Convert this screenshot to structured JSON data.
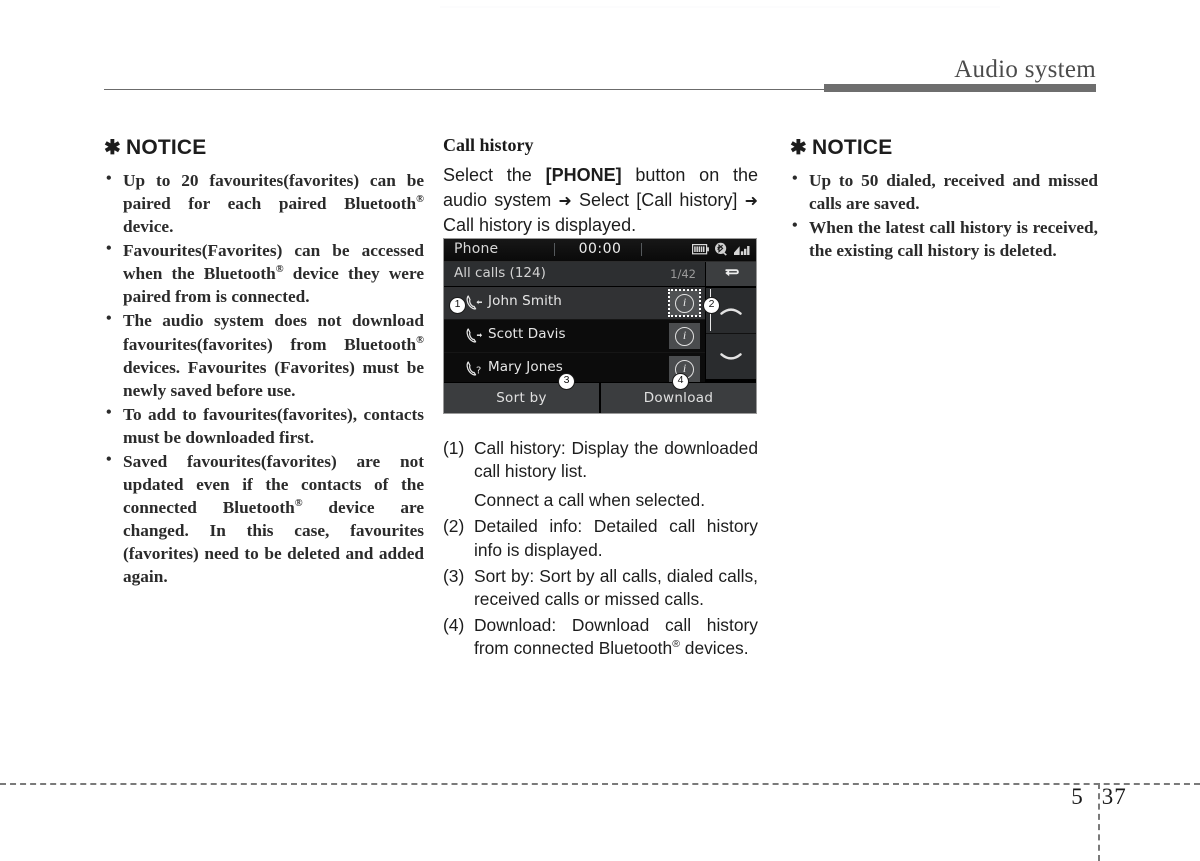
{
  "header": {
    "title": "Audio system"
  },
  "footer": {
    "chapter": "5",
    "page": "37"
  },
  "left_notice": {
    "star": "✱",
    "heading": "NOTICE",
    "items": [
      "Up to 20 favourites(favorites) can be paired for each paired Bluetooth® device.",
      "Favourites(Favorites) can be accessed when the Bluetooth® device they were paired from is connected.",
      "The audio system does not download favourites(favorites) from Bluetooth® devices. Favourites (Favorites) must be newly saved before use.",
      "To add to favourites(favorites), contacts must be downloaded first.",
      "Saved favourites(favorites) are not updated even if the contacts of the connected Bluetooth® device are changed. In this case, favourites (favorites) need to be deleted and added again."
    ]
  },
  "right_notice": {
    "star": "✱",
    "heading": "NOTICE",
    "items": [
      "Up to 50 dialed, received and missed calls are saved.",
      "When the latest call history is received, the existing call history is deleted."
    ]
  },
  "middle": {
    "section_title": "Call history",
    "description_part1": "Select the ",
    "description_phone_button": "[PHONE]",
    "description_part2": " button on the audio system ",
    "description_arrow1": "➜",
    "description_part3": " Select [Call history] ",
    "description_arrow2": "➜",
    "description_part4": " Call history is displayed.",
    "numbered_items": [
      {
        "marker": "(1)",
        "text": "Call history: Display the downloaded call history list.",
        "sub_line": "Connect a call when selected."
      },
      {
        "marker": "(2)",
        "text": "Detailed info: Detailed call history info is displayed.",
        "sub_line": ""
      },
      {
        "marker": "(3)",
        "text": "Sort by: Sort by all calls, dialed calls, received calls or missed calls.",
        "sub_line": ""
      },
      {
        "marker": "(4)",
        "text_before_reg": "Download: Download call history from connected Bluetooth",
        "reg": "®",
        "text_after_reg": " devices.",
        "sub_line": ""
      }
    ]
  },
  "device": {
    "title": "Phone",
    "clock": "00:00",
    "status_icons": [
      "battery-icon",
      "bluetooth-icon",
      "signal-icon"
    ],
    "subbar_label": "All calls (124)",
    "page_indicator": "1/42",
    "back_label": "back-arrow-icon",
    "scroll_up_label": "chevron-up-icon",
    "scroll_down_label": "chevron-down-icon",
    "rows": [
      {
        "name": "John Smith",
        "call_type": "incoming",
        "selected": true,
        "info_label": "i"
      },
      {
        "name": "Scott Davis",
        "call_type": "outgoing",
        "selected": false,
        "info_label": "i"
      },
      {
        "name": "Mary Jones",
        "call_type": "missed",
        "selected": false,
        "info_label": "i"
      }
    ],
    "soft_buttons": [
      {
        "label": "Sort by"
      },
      {
        "label": "Download"
      }
    ],
    "callouts": [
      "1",
      "2",
      "3",
      "4"
    ],
    "colors": {
      "screen_bg": "#000000",
      "selected_row": "#313234",
      "soft_button": "#3b3d3f",
      "subbar": "#2d2f31"
    }
  }
}
